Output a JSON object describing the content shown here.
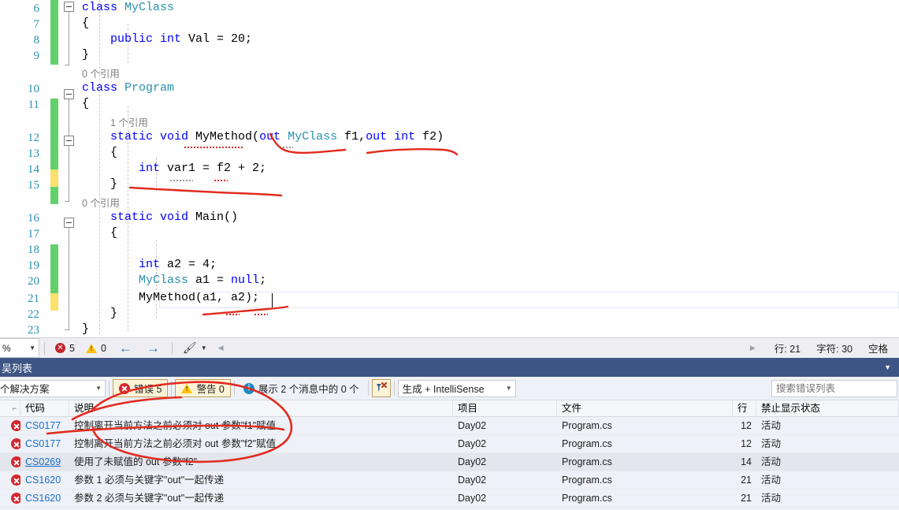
{
  "editor": {
    "line_numbers": [
      6,
      7,
      8,
      9,
      10,
      11,
      12,
      13,
      14,
      15,
      16,
      17,
      18,
      19,
      20,
      21,
      22,
      23
    ],
    "code_lines": [
      {
        "n": 6,
        "text": "class MyClass"
      },
      {
        "n": 7,
        "text": "{"
      },
      {
        "n": 8,
        "text": "    public int Val = 20;"
      },
      {
        "n": 9,
        "text": "}"
      },
      {
        "n": 10,
        "text": "class Program"
      },
      {
        "n": 11,
        "text": "{"
      },
      {
        "n": 12,
        "text": "    static void MyMethod(out MyClass f1,out int f2)"
      },
      {
        "n": 13,
        "text": "    {"
      },
      {
        "n": 14,
        "text": "        int var1 = f2 + 2;"
      },
      {
        "n": 15,
        "text": "    }"
      },
      {
        "n": 16,
        "text": "    static void Main()"
      },
      {
        "n": 17,
        "text": "    {"
      },
      {
        "n": 18,
        "text": ""
      },
      {
        "n": 19,
        "text": "        int a2 = 4;"
      },
      {
        "n": 20,
        "text": "        MyClass a1 = null;"
      },
      {
        "n": 21,
        "text": "        MyMethod(a1, a2);"
      },
      {
        "n": 22,
        "text": "    }"
      },
      {
        "n": 23,
        "text": "}"
      }
    ],
    "code_tokens": {
      "l6": [
        {
          "t": "class ",
          "c": "kw"
        },
        {
          "t": "MyClass",
          "c": "ty"
        }
      ],
      "l7": [
        {
          "t": "{",
          "c": ""
        }
      ],
      "l8": [
        {
          "t": "    ",
          "c": ""
        },
        {
          "t": "public ",
          "c": "kw"
        },
        {
          "t": "int ",
          "c": "kw"
        },
        {
          "t": "Val = 20;",
          "c": ""
        }
      ],
      "l9": [
        {
          "t": "}",
          "c": ""
        }
      ],
      "l10": [
        {
          "t": "class ",
          "c": "kw"
        },
        {
          "t": "Program",
          "c": "ty"
        }
      ],
      "l11": [
        {
          "t": "{",
          "c": ""
        }
      ],
      "l12": [
        {
          "t": "    ",
          "c": ""
        },
        {
          "t": "static ",
          "c": "kw"
        },
        {
          "t": "void ",
          "c": "kw"
        },
        {
          "t": "MyMethod(",
          "c": ""
        },
        {
          "t": "out ",
          "c": "kw"
        },
        {
          "t": "MyClass",
          "c": "ty"
        },
        {
          "t": " f1,",
          "c": ""
        },
        {
          "t": "out ",
          "c": "kw"
        },
        {
          "t": "int",
          "c": "kw"
        },
        {
          "t": " f2)",
          "c": ""
        }
      ],
      "l13": [
        {
          "t": "    {",
          "c": ""
        }
      ],
      "l14": [
        {
          "t": "        ",
          "c": ""
        },
        {
          "t": "int ",
          "c": "kw"
        },
        {
          "t": "var1 = f2 + 2;",
          "c": ""
        }
      ],
      "l15": [
        {
          "t": "    }",
          "c": ""
        }
      ],
      "l16": [
        {
          "t": "    ",
          "c": ""
        },
        {
          "t": "static ",
          "c": "kw"
        },
        {
          "t": "void ",
          "c": "kw"
        },
        {
          "t": "Main()",
          "c": ""
        }
      ],
      "l17": [
        {
          "t": "    {",
          "c": ""
        }
      ],
      "l18": [
        {
          "t": "",
          "c": ""
        }
      ],
      "l19": [
        {
          "t": "        ",
          "c": ""
        },
        {
          "t": "int ",
          "c": "kw"
        },
        {
          "t": "a2 = 4;",
          "c": ""
        }
      ],
      "l20": [
        {
          "t": "        ",
          "c": ""
        },
        {
          "t": "MyClass",
          "c": "ty"
        },
        {
          "t": " a1 = ",
          "c": ""
        },
        {
          "t": "null",
          "c": "kw"
        },
        {
          "t": ";",
          "c": ""
        }
      ],
      "l21": [
        {
          "t": "        MyMethod(a1, a2);",
          "c": ""
        }
      ],
      "l22": [
        {
          "t": "    }",
          "c": ""
        }
      ],
      "l23": [
        {
          "t": "}",
          "c": ""
        }
      ]
    },
    "codelens": [
      {
        "id": "cl1",
        "text": "0 个引用"
      },
      {
        "id": "cl2",
        "text": "1 个引用"
      },
      {
        "id": "cl3",
        "text": "0 个引用"
      }
    ]
  },
  "statusbar": {
    "zoom": "%",
    "error_count": "5",
    "warning_count": "0",
    "prev_label": "←",
    "next_label": "→",
    "line_label": "行: 21",
    "char_label": "字符: 30",
    "mode_label": "空格"
  },
  "panel": {
    "title": "吴列表",
    "scope_combo": "个解决方案",
    "errors_toggle": "错误 5",
    "warnings_toggle": "警告 0",
    "messages_toggle": "展示 2 个消息中的 0 个",
    "build_combo": "生成 + IntelliSense",
    "search_placeholder": "搜索错误列表",
    "columns": [
      "",
      "代码",
      "说明",
      "项目",
      "文件",
      "行",
      "禁止显示状态"
    ],
    "rows": [
      {
        "severity": "error",
        "code": "CS0177",
        "description": "控制离开当前方法之前必须对 out 参数\"f1\"赋值",
        "project": "Day02",
        "file": "Program.cs",
        "line": "12",
        "suppression": "活动",
        "selected": false,
        "code_underline": false
      },
      {
        "severity": "error",
        "code": "CS0177",
        "description": "控制离开当前方法之前必须对 out 参数\"f2\"赋值",
        "project": "Day02",
        "file": "Program.cs",
        "line": "12",
        "suppression": "活动",
        "selected": false,
        "code_underline": false
      },
      {
        "severity": "error",
        "code": "CS0269",
        "description": "使用了未赋值的 out 参数\"f2\"",
        "project": "Day02",
        "file": "Program.cs",
        "line": "14",
        "suppression": "活动",
        "selected": true,
        "code_underline": true
      },
      {
        "severity": "error",
        "code": "CS1620",
        "description": "参数 1 必须与关键字\"out\"一起传递",
        "project": "Day02",
        "file": "Program.cs",
        "line": "21",
        "suppression": "活动",
        "selected": false,
        "code_underline": false
      },
      {
        "severity": "error",
        "code": "CS1620",
        "description": "参数 2 必须与关键字\"out\"一起传递",
        "project": "Day02",
        "file": "Program.cs",
        "line": "21",
        "suppression": "活动",
        "selected": false,
        "code_underline": false
      }
    ]
  },
  "colors": {
    "keyword": "#0000ff",
    "type": "#2b91af",
    "linenumber": "#2b91af",
    "panel_title_bg": "#3d5584",
    "annotation_red": "#e03030",
    "change_green": "#62d16b",
    "change_yellow": "#fbe06a",
    "error_red": "#d6272e"
  }
}
